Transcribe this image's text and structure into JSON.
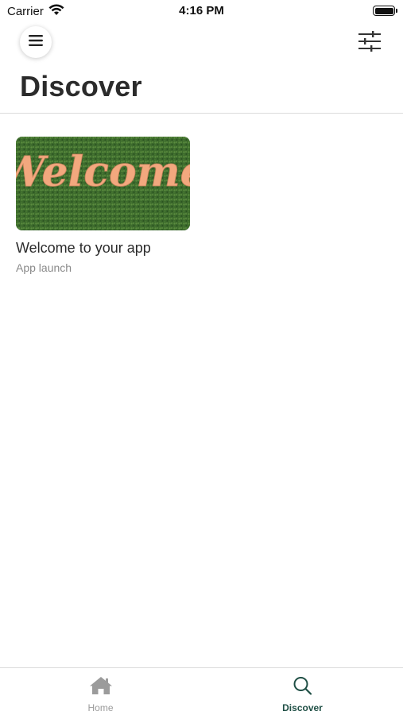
{
  "status_bar": {
    "carrier": "Carrier",
    "time": "4:16 PM",
    "icons": [
      "wifi-icon",
      "battery-icon"
    ]
  },
  "header": {
    "title": "Discover",
    "menu_icon": "hamburger-menu-icon",
    "filter_icon": "sliders-filter-icon"
  },
  "cards": [
    {
      "title": "Welcome to your app",
      "subtitle": "App launch",
      "image_text": "Welcome"
    }
  ],
  "tab_bar": {
    "items": [
      {
        "label": "Home",
        "icon": "house-icon",
        "active": false
      },
      {
        "label": "Discover",
        "icon": "search-icon",
        "active": true
      }
    ]
  },
  "colors": {
    "accent": "#1f4f45",
    "inactive": "#9b9b9b",
    "title": "#2b2b2b",
    "subtitle": "#8a8a8a",
    "card_image_bg": "#3f6b2e",
    "card_image_text": "#f2a87e"
  }
}
